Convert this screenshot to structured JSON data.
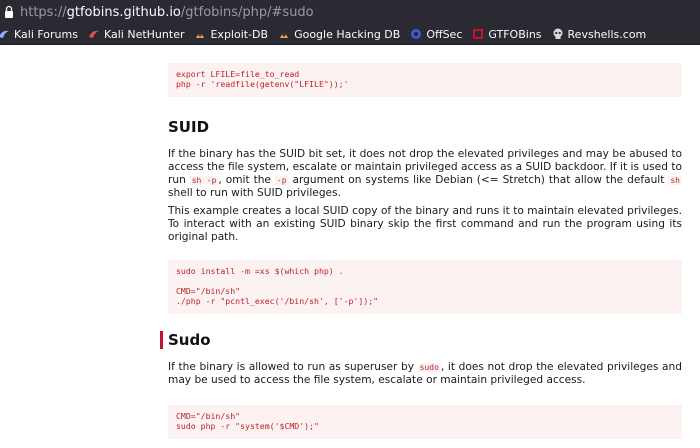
{
  "browser": {
    "url_prefix": "https://",
    "url_host": "gtfobins.github.io",
    "url_path": "/gtfobins/php/#sudo",
    "bookmarks": [
      {
        "label": "Kali Forums",
        "icon": "kali-dragon-icon"
      },
      {
        "label": "Kali NetHunter",
        "icon": "kali-dragon-icon"
      },
      {
        "label": "Exploit-DB",
        "icon": "exploit-db-icon"
      },
      {
        "label": "Google Hacking DB",
        "icon": "exploit-db-icon"
      },
      {
        "label": "OffSec",
        "icon": "offsec-icon"
      },
      {
        "label": "GTFOBins",
        "icon": "gtfobins-icon"
      },
      {
        "label": "Revshells.com",
        "icon": "skull-icon"
      }
    ]
  },
  "content": {
    "top_code": "export LFILE=file_to_read\nphp -r 'readfile(getenv(\"LFILE\"));'",
    "suid": {
      "heading": "SUID",
      "p1_a": "If the binary has the SUID bit set, it does not drop the elevated privileges and may be abused to access the file system, escalate or maintain privileged access as a SUID backdoor. If it is used to run ",
      "p1_code1": "sh -p",
      "p1_b": ", omit the ",
      "p1_code2": "-p",
      "p1_c": " argument on systems like Debian (<= Stretch) that allow the default ",
      "p1_code3": "sh",
      "p1_d": " shell to run with SUID privileges.",
      "p2": "This example creates a local SUID copy of the binary and runs it to maintain elevated privileges. To interact with an existing SUID binary skip the first command and run the program using its original path.",
      "code": "sudo install -m =xs $(which php) .\n\nCMD=\"/bin/sh\"\n./php -r \"pcntl_exec('/bin/sh', ['-p']);\""
    },
    "sudo": {
      "heading": "Sudo",
      "p1_a": "If the binary is allowed to run as superuser by ",
      "p1_code": "sudo",
      "p1_b": ", it does not drop the elevated privileges and may be used to access the file system, escalate or maintain privileged access.",
      "code": "CMD=\"/bin/sh\"\nsudo php -r \"system('$CMD');\""
    }
  },
  "colors": {
    "chrome_bg": "#2b2a33",
    "code_bg": "#fdf2f2",
    "code_fg": "#b8232b",
    "heading_accent": "#c4122d"
  }
}
